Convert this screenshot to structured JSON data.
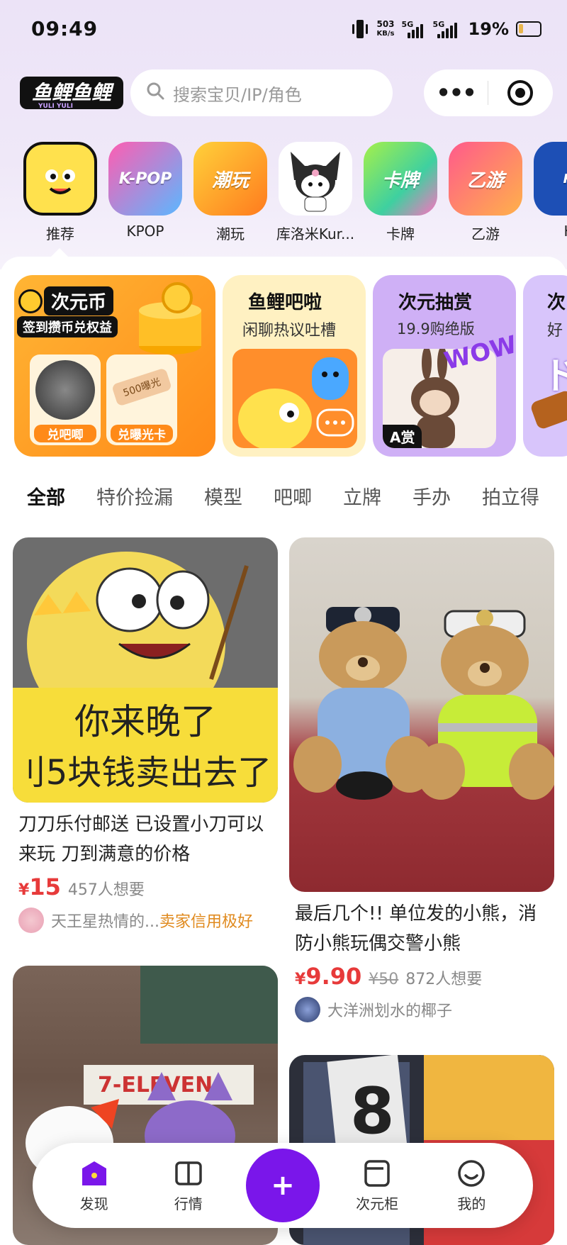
{
  "status": {
    "time": "09:49",
    "speed_value": "503",
    "speed_unit": "KB/s",
    "net1": "5G",
    "net2": "5G",
    "battery": "19%"
  },
  "header": {
    "logo_text": "鱼鲤鱼鲤",
    "logo_sub": "YULI YULI",
    "search_placeholder": "搜索宝贝/IP/角色",
    "more_icon": "more-dots-icon",
    "record_icon": "target-icon"
  },
  "categories": [
    {
      "label": "推荐",
      "icon_text": "",
      "color": "#ffe14d"
    },
    {
      "label": "KPOP",
      "icon_text": "K-POP",
      "color": "#f45bb5"
    },
    {
      "label": "潮玩",
      "icon_text": "潮玩",
      "color": "#ff8f2e"
    },
    {
      "label": "库洛米Kur...",
      "icon_text": "",
      "color": "#ffffff"
    },
    {
      "label": "卡牌",
      "icon_text": "卡牌",
      "color": "#5fd46a"
    },
    {
      "label": "乙游",
      "icon_text": "乙游",
      "color": "#ff6fa8"
    },
    {
      "label": "KI",
      "icon_text": "",
      "color": "#1d4fb5"
    }
  ],
  "banners": {
    "coin": {
      "title": "次元币",
      "sub": "签到攒币兑权益",
      "btn1": "兑吧唧",
      "btn2": "兑曝光卡",
      "card_text": "500曝光"
    },
    "chat": {
      "title": "鱼鲤吧啦",
      "sub": "闲聊热议吐槽"
    },
    "lottery": {
      "title": "次元抽赏",
      "sub": "19.9购绝版",
      "badge": "A赏",
      "sticker": "WOW"
    },
    "partial": {
      "title": "次",
      "sub": "好",
      "extra": "ド"
    }
  },
  "tabs": [
    "全部",
    "特价捡漏",
    "模型",
    "吧唧",
    "立牌",
    "手办",
    "拍立得"
  ],
  "products": [
    {
      "image_text_1": "你来晚了",
      "image_text_2": "刂5块钱卖出去了",
      "title": "刀刀乐付邮送 已设置小刀可以来玩 刀到满意的价格",
      "currency": "¥",
      "price": "15",
      "old_price": "",
      "wants": "457人想要",
      "seller": "天王星热情的...",
      "tag": "卖家信用极好"
    },
    {
      "title": "最后几个!! 单位发的小熊，消防小熊玩偶交警小熊",
      "currency": "¥",
      "price": "9.90",
      "old_price": "¥50",
      "wants": "872人想要",
      "seller": "大洋洲划水的椰子",
      "tag": ""
    },
    {
      "image_text_1": "7-ELEVEN."
    },
    {
      "image_text_1": "8"
    }
  ],
  "nav": [
    {
      "label": "发现",
      "icon": "discover-icon"
    },
    {
      "label": "行情",
      "icon": "book-icon"
    },
    {
      "label": "",
      "icon": "plus-icon"
    },
    {
      "label": "次元柜",
      "icon": "cabinet-icon"
    },
    {
      "label": "我的",
      "icon": "smile-icon"
    }
  ],
  "colors": {
    "accent": "#7a16ea",
    "price": "#e73a3a",
    "tab_underline": "#ffd83a",
    "credit": "#e08a1e"
  }
}
